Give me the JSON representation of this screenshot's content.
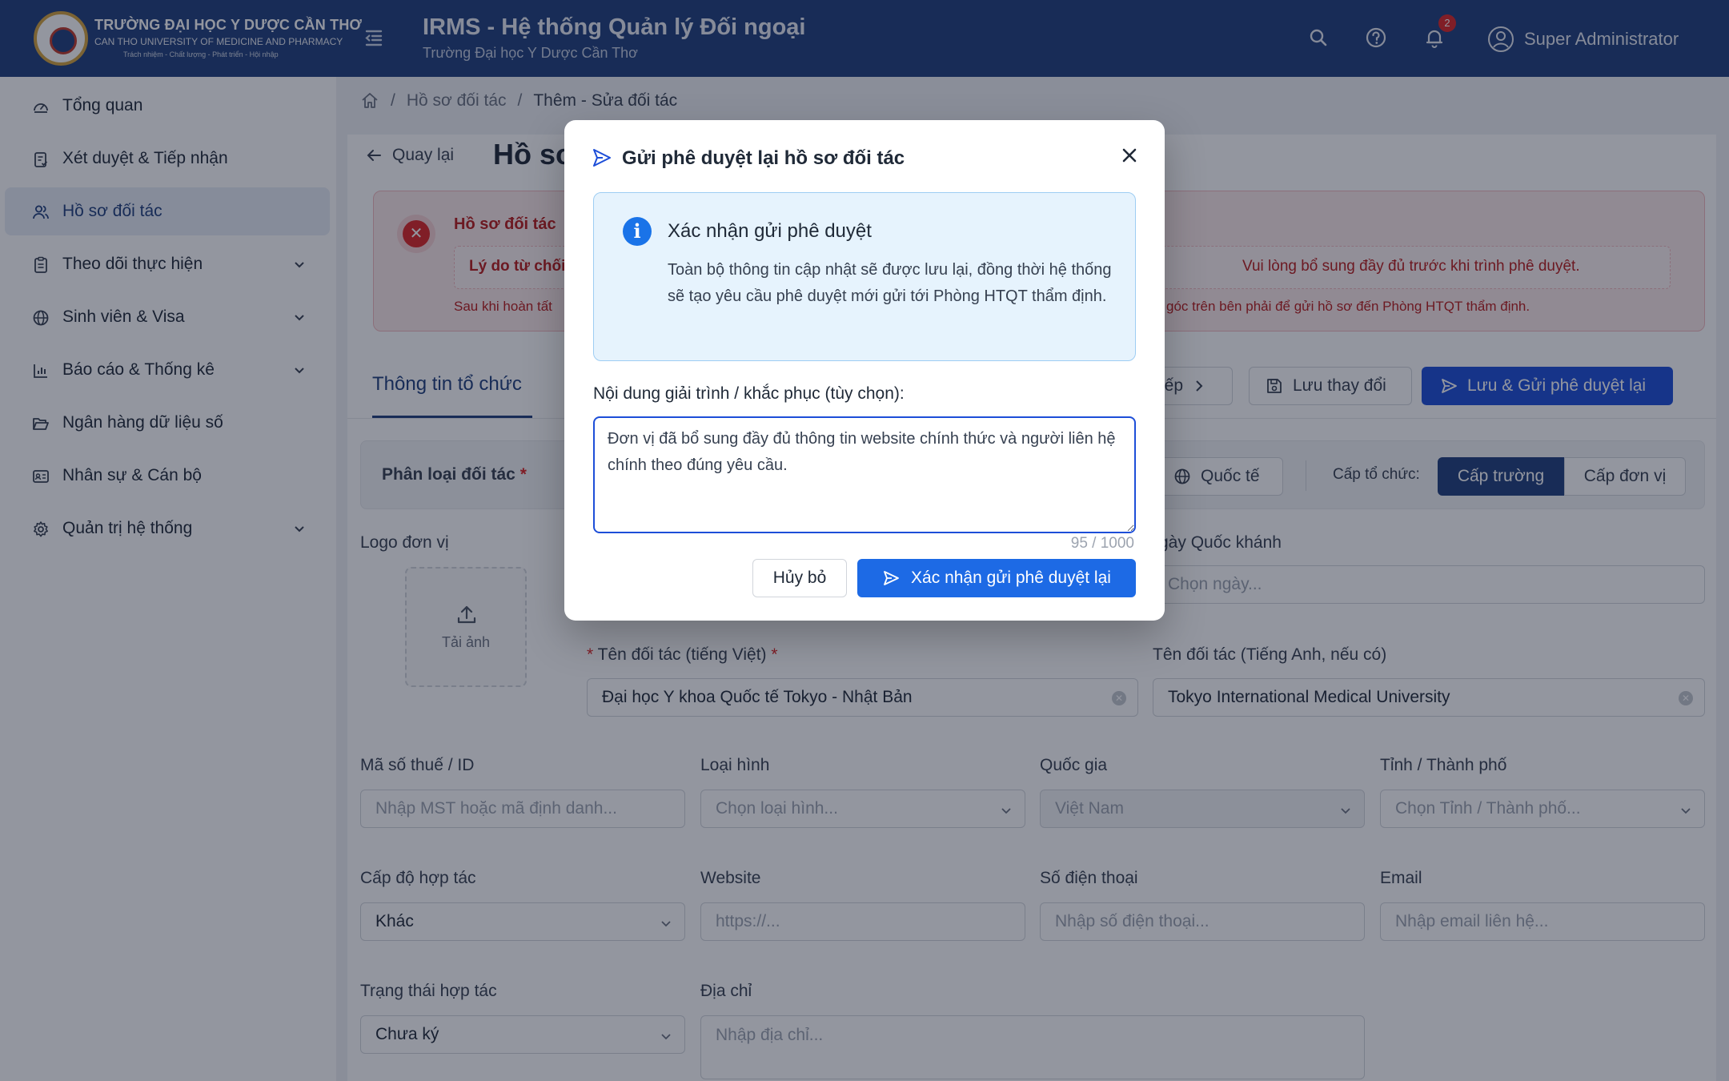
{
  "header": {
    "uni_name": "TRƯỜNG ĐẠI HỌC Y DƯỢC CẦN THƠ",
    "uni_name_en": "CAN THO UNIVERSITY OF MEDICINE AND PHARMACY",
    "uni_motto": "Trách nhiệm - Chất lượng - Phát triển - Hội nhập",
    "app_title": "IRMS - Hệ thống Quản lý Đối ngoại",
    "app_subtitle": "Trường Đại học Y Dược Cần Thơ",
    "notification_count": "2",
    "user_name": "Super Administrator",
    "color": "#1f3f7c"
  },
  "sidebar": {
    "items": [
      {
        "label": "Tổng quan",
        "icon": "dashboard-icon"
      },
      {
        "label": "Xét duyệt & Tiếp nhận",
        "icon": "clipboard-check-icon"
      },
      {
        "label": "Hồ sơ đối tác",
        "icon": "users-icon",
        "active": true
      },
      {
        "label": "Theo dõi thực hiện",
        "icon": "clipboard-list-icon",
        "expandable": true
      },
      {
        "label": "Sinh viên & Visa",
        "icon": "globe-icon",
        "expandable": true
      },
      {
        "label": "Báo cáo & Thống kê",
        "icon": "bar-chart-icon",
        "expandable": true
      },
      {
        "label": "Ngân hàng dữ liệu số",
        "icon": "folder-open-icon"
      },
      {
        "label": "Nhân sự & Cán bộ",
        "icon": "id-card-icon"
      },
      {
        "label": "Quản trị hệ thống",
        "icon": "gear-icon",
        "expandable": true
      }
    ]
  },
  "breadcrumb": {
    "level1": "Hồ sơ đối tác",
    "current": "Thêm - Sửa đối tác"
  },
  "page": {
    "back_label": "Quay lại",
    "title_visible": "Hồ sơ",
    "alert": {
      "title": "Hồ sơ đối tác",
      "reason_label": "Lý do từ chối",
      "reason_tail": "Vui lòng bổ sung đầy đủ trước khi trình phê duyệt.",
      "note_head": "Sau khi hoàn tất",
      "note_tail": "góc trên bên phải để gửi hồ sơ đến Phòng HTQT thẩm định."
    },
    "tab_active": "Thông tin tổ chức",
    "btn_next": "iếp",
    "btn_save": "Lưu thay đổi",
    "btn_save_send": "Lưu & Gửi phê duyệt lại",
    "partner_type_label": "Phân loại đối tác",
    "intl_label": "Quốc tế",
    "org_level_label": "Cấp tổ chức:",
    "org_level_school": "Cấp trường",
    "org_level_unit": "Cấp đơn vị"
  },
  "form": {
    "logo_label": "Logo đơn vị",
    "upload_label": "Tải ảnh",
    "national_day_label": "gày Quốc khánh",
    "national_day_placeholder": "Chọn ngày...",
    "name_vi_label": "Tên đối tác (tiếng Việt)",
    "name_vi_value": "Đại học Y khoa Quốc tế Tokyo - Nhật Bản",
    "name_en_label": "Tên đối tác (Tiếng Anh, nếu có)",
    "name_en_value": "Tokyo International Medical University",
    "tax_label": "Mã số thuế / ID",
    "tax_placeholder": "Nhập MST hoặc mã định danh...",
    "type_label": "Loại hình",
    "type_placeholder": "Chọn loại hình...",
    "country_label": "Quốc gia",
    "country_value": "Việt Nam",
    "province_label": "Tỉnh / Thành phố",
    "province_placeholder": "Chọn Tỉnh / Thành phố...",
    "coop_level_label": "Cấp độ hợp tác",
    "coop_level_value": "Khác",
    "website_label": "Website",
    "website_placeholder": "https://...",
    "phone_label": "Số điện thoại",
    "phone_placeholder": "Nhập số điện thoại...",
    "email_label": "Email",
    "email_placeholder": "Nhập email liên hệ...",
    "status_label": "Trạng thái hợp tác",
    "status_value": "Chưa ký",
    "address_label": "Địa chỉ",
    "address_placeholder": "Nhập địa chỉ..."
  },
  "modal": {
    "title": "Gửi phê duyệt lại hồ sơ đối tác",
    "info_title": "Xác nhận gửi phê duyệt",
    "info_body": "Toàn bộ thông tin cập nhật sẽ được lưu lại, đồng thời hệ thống sẽ tạo yêu cầu phê duyệt mới gửi tới Phòng HTQT thẩm định.",
    "textarea_label": "Nội dung giải trình / khắc phục (tùy chọn):",
    "textarea_value": "Đơn vị đã bổ sung đầy đủ thông tin website chính thức và người liên hệ chính theo đúng yêu cầu.",
    "char_count": "95 / 1000",
    "cancel_label": "Hủy bỏ",
    "confirm_label": "Xác nhận gửi phê duyệt lại",
    "accent": "#1d6ae5"
  }
}
